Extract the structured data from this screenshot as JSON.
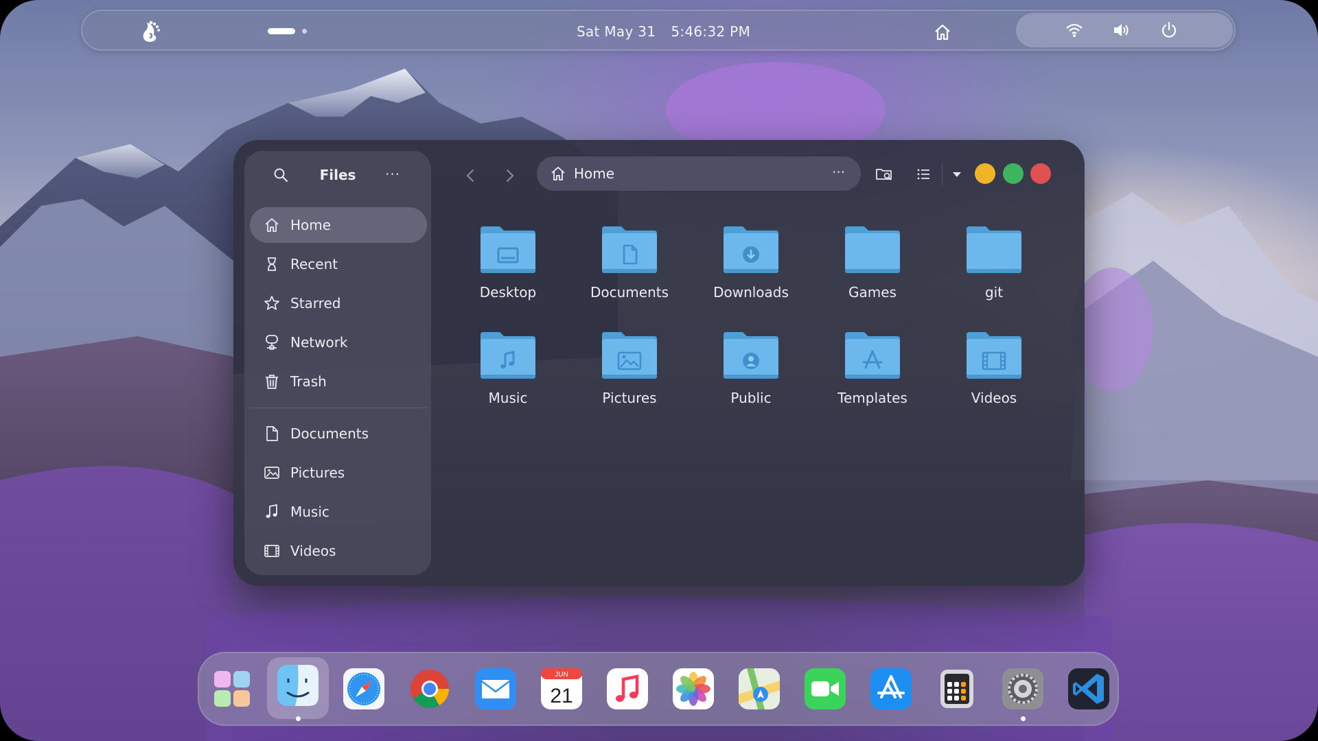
{
  "topbar": {
    "date": "Sat May 31",
    "time": "5:46:32 PM",
    "icons": [
      "gnome-foot-icon",
      "home-icon",
      "wifi-icon",
      "volume-icon",
      "power-icon"
    ]
  },
  "window": {
    "sidebar": {
      "title": "Files",
      "more": "···",
      "items": [
        {
          "label": "Home",
          "icon": "home-icon"
        },
        {
          "label": "Recent",
          "icon": "hourglass-icon"
        },
        {
          "label": "Starred",
          "icon": "star-icon"
        },
        {
          "label": "Network",
          "icon": "network-icon"
        },
        {
          "label": "Trash",
          "icon": "trash-icon"
        }
      ],
      "bookmarks": [
        {
          "label": "Documents",
          "icon": "document-icon"
        },
        {
          "label": "Pictures",
          "icon": "picture-icon"
        },
        {
          "label": "Music",
          "icon": "music-icon"
        },
        {
          "label": "Videos",
          "icon": "video-icon"
        }
      ]
    },
    "pathbar": {
      "location": "Home",
      "more": "···"
    },
    "controls": {
      "minimize_color": "#f0b429",
      "maximize_color": "#3fb45e",
      "close_color": "#e05252"
    },
    "folders": [
      {
        "name": "Desktop",
        "icon": "desktop-icon"
      },
      {
        "name": "Documents",
        "icon": "document-icon"
      },
      {
        "name": "Downloads",
        "icon": "download-icon"
      },
      {
        "name": "Games",
        "icon": "folder-icon"
      },
      {
        "name": "git",
        "icon": "folder-icon"
      },
      {
        "name": "Music",
        "icon": "music-icon"
      },
      {
        "name": "Pictures",
        "icon": "picture-icon"
      },
      {
        "name": "Public",
        "icon": "user-icon"
      },
      {
        "name": "Templates",
        "icon": "template-icon"
      },
      {
        "name": "Videos",
        "icon": "video-icon"
      }
    ]
  },
  "dock": {
    "apps": [
      "app-grid",
      "finder",
      "safari",
      "chrome",
      "mail",
      "calendar",
      "music",
      "photos",
      "maps",
      "facetime",
      "app-store",
      "calculator",
      "system-settings",
      "vscode"
    ],
    "calendar_month": "JUN",
    "calendar_day": "21"
  }
}
